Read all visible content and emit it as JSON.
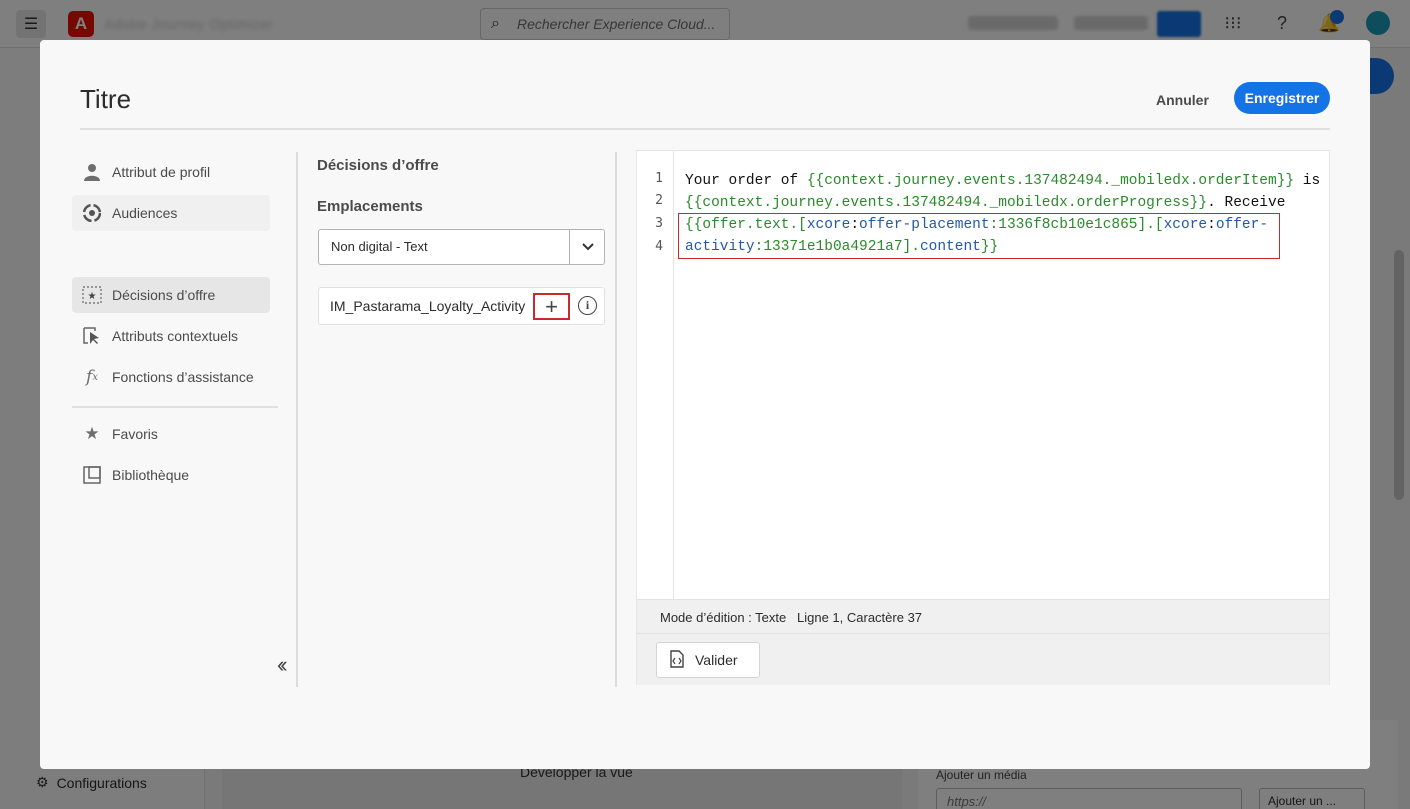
{
  "background_app": {
    "app_name": "Adobe Journey Optimizer",
    "search_placeholder": "Rechercher Experience Cloud...",
    "nav_configurations": "Configurations",
    "canvas_expand_label": "Développer la vue",
    "media_label": "Ajouter un média",
    "media_url_placeholder": "https://",
    "media_add_label": "Ajouter un ..."
  },
  "modal": {
    "title": "Titre",
    "cancel_label": "Annuler",
    "save_label": "Enregistrer"
  },
  "menu": {
    "items": [
      {
        "label": "Attribut de profil",
        "icon": "user-icon"
      },
      {
        "label": "Audiences",
        "icon": "audience-icon"
      },
      {
        "label": "Décisions d’offre",
        "icon": "offer-decision-icon"
      },
      {
        "label": "Attributs contextuels",
        "icon": "contextual-attribute-icon"
      },
      {
        "label": "Fonctions d’assistance",
        "icon": "function-icon"
      },
      {
        "label": "Favoris",
        "icon": "star-icon"
      },
      {
        "label": "Bibliothèque",
        "icon": "library-icon"
      }
    ],
    "selected": "Décisions d’offre"
  },
  "offers_panel": {
    "title": "Décisions d’offre",
    "placements_label": "Emplacements",
    "placement_value": "Non digital - Text",
    "offer_name": "IM_Pastarama_Loyalty_Activity"
  },
  "editor": {
    "line_numbers": [
      "1",
      "2",
      "3",
      "4"
    ],
    "line1_text": "Your order of ",
    "line1_expr": "{{context.journey.events.137482494._mobiledx.orderItem}}",
    "line1_tail": " is",
    "line2_expr": "{{context.journey.events.137482494._mobiledx.orderProgress}}",
    "line2_tail": ". Receive",
    "line3_a": "{{offer.text.[",
    "line3_b": "xcore",
    "line3_c": ":",
    "line3_d": "offer-placement",
    "line3_e": ":1336f8cb10e1c865].[",
    "line3_f": "xcore",
    "line3_g": ":",
    "line3_h": "offer-",
    "line4_a": "activity",
    "line4_b": ":13371e1b0a4921a7].",
    "line4_c": "content",
    "line4_d": "}}",
    "mode_label": "Mode d’édition : Texte",
    "cursor_position": "Ligne 1, Caractère 37",
    "validate_label": "Valider"
  }
}
